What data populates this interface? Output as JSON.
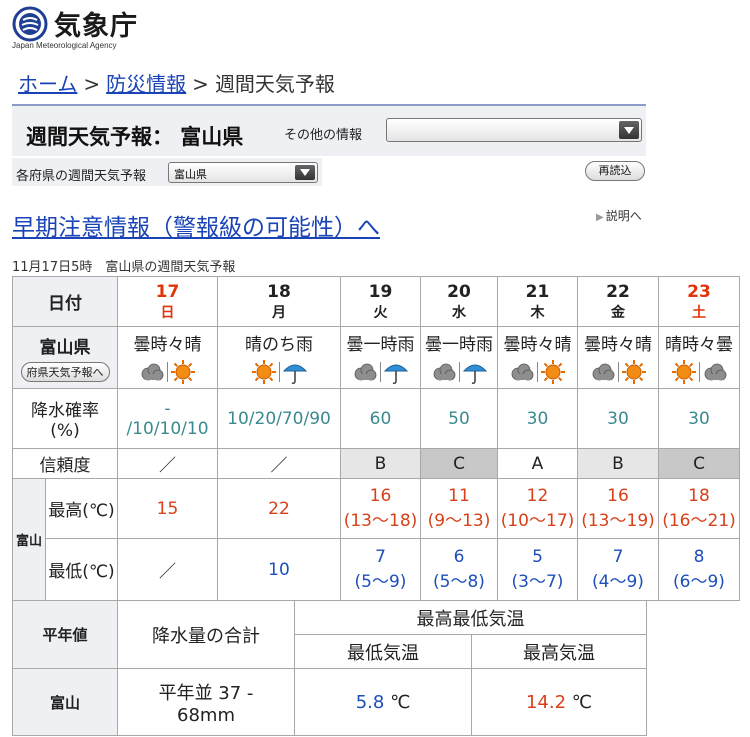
{
  "header": {
    "agency_name": "気象庁",
    "agency_sub": "Japan Meteorological Agency"
  },
  "breadcrumb": {
    "home": "ホーム",
    "sep1": ">",
    "disaster": "防災情報",
    "sep2": ">",
    "current": "週間天気予報"
  },
  "title": {
    "page_title": "週間天気予報：  富山県",
    "other_info_label": "その他の情報",
    "other_info_value": ""
  },
  "pref_selector": {
    "label": "各府県の週間天気予報",
    "value": "富山県"
  },
  "reload_label": "再読込",
  "early_warning_link": "早期注意情報（警報級の可能性）へ",
  "explain_link": "説明へ",
  "issued": "11月17日5時　富山県の週間天気予報",
  "table": {
    "date_label": "日付",
    "region_label": "富山県",
    "pref_forecast_button": "府県天気予報へ",
    "pop_label_1": "降水確率",
    "pop_label_2": "(%)",
    "reliability_label": "信頼度",
    "city_label": "富山",
    "max_label": "最高(℃)",
    "min_label": "最低(℃)",
    "days": [
      {
        "date": "17",
        "wd": "日",
        "wx": "曇時々晴",
        "pop_1": "-",
        "pop_2": "/10/10/10",
        "rel": "／",
        "max": "15",
        "max_range": "",
        "min": "／",
        "min_range": ""
      },
      {
        "date": "18",
        "wd": "月",
        "wx": "晴のち雨",
        "pop_1": "10/20/70/90",
        "pop_2": "",
        "rel": "／",
        "max": "22",
        "max_range": "",
        "min": "10",
        "min_range": ""
      },
      {
        "date": "19",
        "wd": "火",
        "wx": "曇一時雨",
        "pop_1": "60",
        "pop_2": "",
        "rel": "B",
        "max": "16",
        "max_range": "(13〜18)",
        "min": "7",
        "min_range": "(5〜9)"
      },
      {
        "date": "20",
        "wd": "水",
        "wx": "曇一時雨",
        "pop_1": "50",
        "pop_2": "",
        "rel": "C",
        "max": "11",
        "max_range": "(9〜13)",
        "min": "6",
        "min_range": "(5〜8)"
      },
      {
        "date": "21",
        "wd": "木",
        "wx": "曇時々晴",
        "pop_1": "30",
        "pop_2": "",
        "rel": "A",
        "max": "12",
        "max_range": "(10〜17)",
        "min": "5",
        "min_range": "(3〜7)"
      },
      {
        "date": "22",
        "wd": "金",
        "wx": "曇時々晴",
        "pop_1": "30",
        "pop_2": "",
        "rel": "B",
        "max": "16",
        "max_range": "(13〜19)",
        "min": "7",
        "min_range": "(4〜9)"
      },
      {
        "date": "23",
        "wd": "土",
        "wx": "晴時々曇",
        "pop_1": "30",
        "pop_2": "",
        "rel": "C",
        "max": "18",
        "max_range": "(16〜21)",
        "min": "8",
        "min_range": "(6〜9)"
      }
    ]
  },
  "normals": {
    "label": "平年値",
    "precip_header": "降水量の合計",
    "temp_header": "最高最低気温",
    "min_header": "最低気温",
    "max_header": "最高気温",
    "city": "富山",
    "precip_value_1": "平年並 37 -",
    "precip_value_2": "68mm",
    "min_value": "5.8",
    "max_value": "14.2",
    "unit": "℃"
  },
  "colors": {
    "sunday_saturday": "#e0350b",
    "link": "#1a43b8",
    "pop_text": "#3a8a8f",
    "max_temp": "#d8401a",
    "min_temp": "#1c4fbb"
  }
}
